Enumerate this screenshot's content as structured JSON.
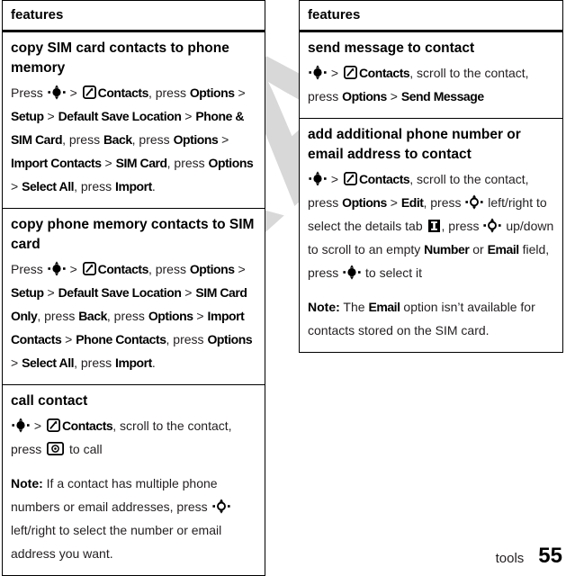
{
  "document": {
    "watermark": "DRAFT",
    "footer": {
      "chapter": "tools",
      "page_number": "55"
    }
  },
  "columns": [
    {
      "header": "features",
      "sections": [
        {
          "title": "copy SIM card contacts to phone memory",
          "paragraphs": [
            {
              "id": "copy-sim-to-phone-steps",
              "runs": [
                {
                  "t": "text",
                  "v": "Press "
                },
                {
                  "t": "icon",
                  "v": "nav-key-5way-icon"
                },
                {
                  "t": "text",
                  "v": " > "
                },
                {
                  "t": "icon",
                  "v": "contacts-icon"
                },
                {
                  "t": "key",
                  "v": "Contacts"
                },
                {
                  "t": "text",
                  "v": ", press "
                },
                {
                  "t": "key",
                  "v": "Options"
                },
                {
                  "t": "text",
                  "v": " > "
                },
                {
                  "t": "key",
                  "v": "Setup"
                },
                {
                  "t": "text",
                  "v": " > "
                },
                {
                  "t": "key",
                  "v": "Default Save Location"
                },
                {
                  "t": "text",
                  "v": " > "
                },
                {
                  "t": "key",
                  "v": "Phone & SIM Card"
                },
                {
                  "t": "text",
                  "v": ", press "
                },
                {
                  "t": "key",
                  "v": "Back"
                },
                {
                  "t": "text",
                  "v": ", press "
                },
                {
                  "t": "key",
                  "v": "Options"
                },
                {
                  "t": "text",
                  "v": " > "
                },
                {
                  "t": "key",
                  "v": "Import Contacts"
                },
                {
                  "t": "text",
                  "v": " > "
                },
                {
                  "t": "key",
                  "v": "SIM Card"
                },
                {
                  "t": "text",
                  "v": ", press "
                },
                {
                  "t": "key",
                  "v": "Options"
                },
                {
                  "t": "text",
                  "v": " > "
                },
                {
                  "t": "key",
                  "v": "Select All"
                },
                {
                  "t": "text",
                  "v": ", press "
                },
                {
                  "t": "key",
                  "v": "Import"
                },
                {
                  "t": "text",
                  "v": "."
                }
              ]
            }
          ]
        },
        {
          "title": "copy phone memory contacts to SIM card",
          "paragraphs": [
            {
              "id": "copy-phone-to-sim-steps",
              "runs": [
                {
                  "t": "text",
                  "v": "Press "
                },
                {
                  "t": "icon",
                  "v": "nav-key-5way-icon"
                },
                {
                  "t": "text",
                  "v": " > "
                },
                {
                  "t": "icon",
                  "v": "contacts-icon"
                },
                {
                  "t": "key",
                  "v": "Contacts"
                },
                {
                  "t": "text",
                  "v": ", press "
                },
                {
                  "t": "key",
                  "v": "Options"
                },
                {
                  "t": "text",
                  "v": " > "
                },
                {
                  "t": "key",
                  "v": "Setup"
                },
                {
                  "t": "text",
                  "v": " > "
                },
                {
                  "t": "key",
                  "v": "Default Save Location"
                },
                {
                  "t": "text",
                  "v": " > "
                },
                {
                  "t": "key",
                  "v": "SIM Card Only"
                },
                {
                  "t": "text",
                  "v": ", press "
                },
                {
                  "t": "key",
                  "v": "Back"
                },
                {
                  "t": "text",
                  "v": ", press "
                },
                {
                  "t": "key",
                  "v": "Options"
                },
                {
                  "t": "text",
                  "v": " > "
                },
                {
                  "t": "key",
                  "v": "Import Contacts"
                },
                {
                  "t": "text",
                  "v": " > "
                },
                {
                  "t": "key",
                  "v": "Phone Contacts"
                },
                {
                  "t": "text",
                  "v": ", press "
                },
                {
                  "t": "key",
                  "v": "Options"
                },
                {
                  "t": "text",
                  "v": " > "
                },
                {
                  "t": "key",
                  "v": "Select All"
                },
                {
                  "t": "text",
                  "v": ", press "
                },
                {
                  "t": "key",
                  "v": "Import"
                },
                {
                  "t": "text",
                  "v": "."
                }
              ]
            }
          ]
        },
        {
          "title": "call contact",
          "paragraphs": [
            {
              "id": "call-contact-steps",
              "runs": [
                {
                  "t": "icon",
                  "v": "nav-key-5way-icon"
                },
                {
                  "t": "text",
                  "v": " > "
                },
                {
                  "t": "icon",
                  "v": "contacts-icon"
                },
                {
                  "t": "key",
                  "v": "Contacts"
                },
                {
                  "t": "text",
                  "v": ", scroll to the contact, press "
                },
                {
                  "t": "icon",
                  "v": "call-key-icon"
                },
                {
                  "t": "text",
                  "v": " to call"
                }
              ]
            },
            {
              "id": "call-contact-note",
              "runs": [
                {
                  "t": "bold",
                  "v": "Note:"
                },
                {
                  "t": "text",
                  "v": " If a contact has multiple phone numbers or email addresses, press "
                },
                {
                  "t": "icon",
                  "v": "nav-key-ring-icon"
                },
                {
                  "t": "text",
                  "v": " left/right to select the number or email address you want."
                }
              ]
            }
          ]
        }
      ]
    },
    {
      "header": "features",
      "sections": [
        {
          "title": "send message to contact",
          "paragraphs": [
            {
              "id": "send-message-steps",
              "runs": [
                {
                  "t": "icon",
                  "v": "nav-key-5way-icon"
                },
                {
                  "t": "text",
                  "v": " > "
                },
                {
                  "t": "icon",
                  "v": "contacts-icon"
                },
                {
                  "t": "key",
                  "v": "Contacts"
                },
                {
                  "t": "text",
                  "v": ", scroll to the contact, press "
                },
                {
                  "t": "key",
                  "v": "Options"
                },
                {
                  "t": "text",
                  "v": " > "
                },
                {
                  "t": "key",
                  "v": "Send Message"
                }
              ]
            }
          ]
        },
        {
          "title": "add additional phone number or email address to contact",
          "paragraphs": [
            {
              "id": "add-number-steps",
              "runs": [
                {
                  "t": "icon",
                  "v": "nav-key-5way-icon"
                },
                {
                  "t": "text",
                  "v": " > "
                },
                {
                  "t": "icon",
                  "v": "contacts-icon"
                },
                {
                  "t": "key",
                  "v": "Contacts"
                },
                {
                  "t": "text",
                  "v": ", scroll to the contact, press "
                },
                {
                  "t": "key",
                  "v": "Options"
                },
                {
                  "t": "text",
                  "v": " > "
                },
                {
                  "t": "key",
                  "v": "Edit"
                },
                {
                  "t": "text",
                  "v": ", press "
                },
                {
                  "t": "icon",
                  "v": "nav-key-ring-icon"
                },
                {
                  "t": "text",
                  "v": " left/right to select the details tab "
                },
                {
                  "t": "icon",
                  "v": "details-tab-icon"
                },
                {
                  "t": "text",
                  "v": ", press "
                },
                {
                  "t": "icon",
                  "v": "nav-key-ring-icon"
                },
                {
                  "t": "text",
                  "v": " up/down to scroll to an empty "
                },
                {
                  "t": "key",
                  "v": "Number"
                },
                {
                  "t": "text",
                  "v": " or "
                },
                {
                  "t": "key",
                  "v": "Email"
                },
                {
                  "t": "text",
                  "v": " field, press "
                },
                {
                  "t": "icon",
                  "v": "nav-key-5way-icon"
                },
                {
                  "t": "text",
                  "v": " to select it"
                }
              ]
            },
            {
              "id": "add-number-note",
              "runs": [
                {
                  "t": "bold",
                  "v": "Note:"
                },
                {
                  "t": "text",
                  "v": " The "
                },
                {
                  "t": "key",
                  "v": "Email"
                },
                {
                  "t": "text",
                  "v": " option isn’t available for contacts stored on the SIM card."
                }
              ]
            }
          ]
        }
      ]
    }
  ]
}
